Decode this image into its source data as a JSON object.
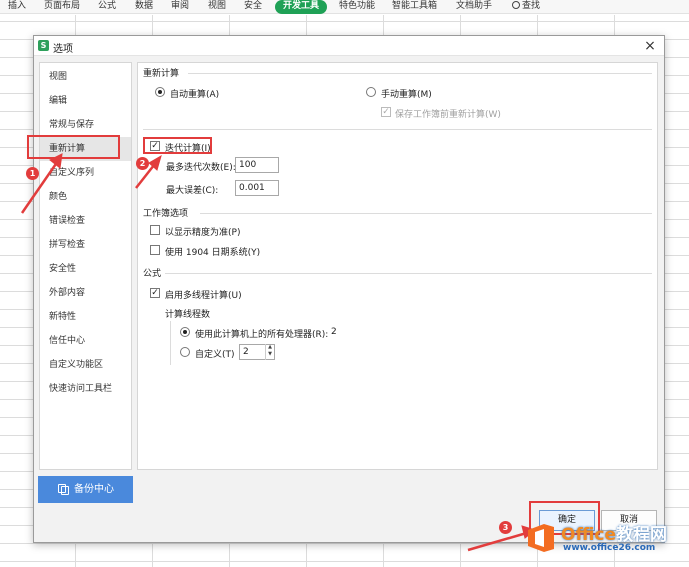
{
  "menubar": {
    "items": [
      "插入",
      "页面布局",
      "公式",
      "数据",
      "审阅",
      "视图",
      "安全",
      "开发工具",
      "特色功能",
      "智能工具箱",
      "文档助手"
    ],
    "search_label": "查找",
    "active_item": "开发工具",
    "accent_color": "#1fa156"
  },
  "dialog": {
    "title": "选项",
    "title_icon": "S",
    "close_symbol": "×",
    "sidebar": {
      "items": [
        "视图",
        "编辑",
        "常规与保存",
        "重新计算",
        "自定义序列",
        "颜色",
        "错误检查",
        "拼写检查",
        "安全性",
        "外部内容",
        "新特性",
        "信任中心",
        "自定义功能区",
        "快速访问工具栏"
      ],
      "selected": "重新计算"
    },
    "backup_label": "备份中心",
    "recalc": {
      "section_title": "重新计算",
      "auto_label": "自动重算(A)",
      "manual_label": "手动重算(M)",
      "save_before_label": "保存工作簿前重新计算(W)",
      "iteration_label": "迭代计算(I)",
      "max_iterations_label": "最多迭代次数(E):",
      "max_iterations_value": "100",
      "max_change_label": "最大误差(C):",
      "max_change_value": "0.001"
    },
    "workbook": {
      "section_title": "工作簿选项",
      "precision_label": "以显示精度为准(P)",
      "date1904_label": "使用 1904 日期系统(Y)"
    },
    "formula": {
      "section_title": "公式",
      "multithread_label": "启用多线程计算(U)",
      "threads_title": "计算线程数",
      "all_processors_label": "使用此计算机上的所有处理器(R):",
      "all_processors_value": "2",
      "manual_label": "自定义(T)",
      "manual_value": "2"
    },
    "ok_label": "确定",
    "cancel_label": "取消"
  },
  "annotations": {
    "markers": [
      "1",
      "2",
      "3"
    ],
    "color": "#e23c3c"
  },
  "watermark": {
    "brand_office": "Office",
    "brand_rest": "教程网",
    "url": "www.office26.com"
  }
}
